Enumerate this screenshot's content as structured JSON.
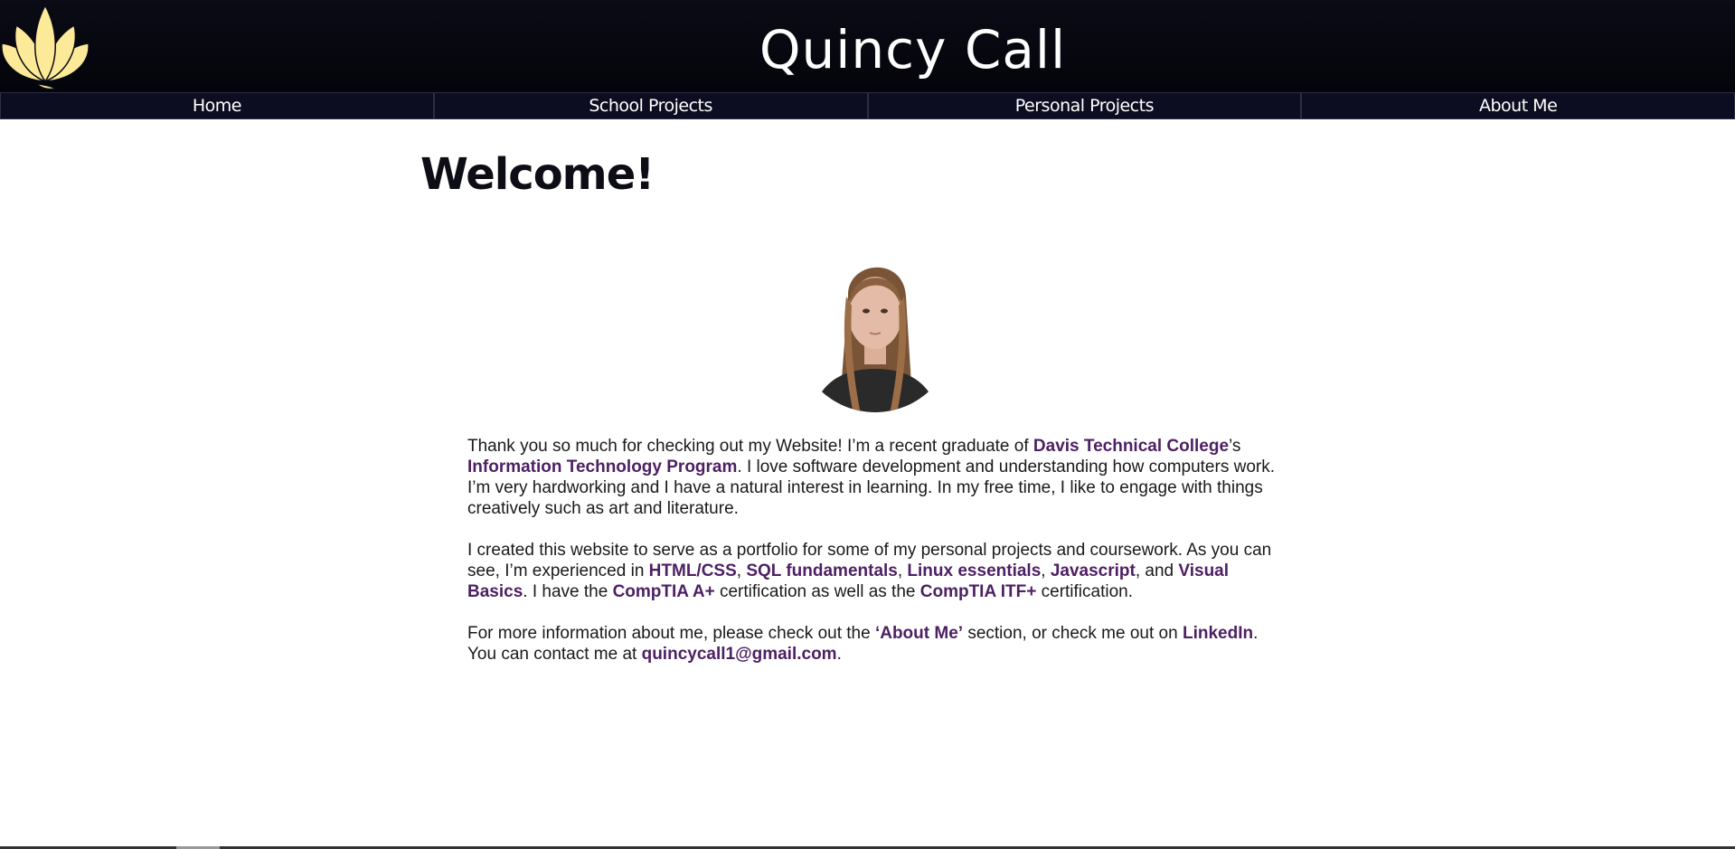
{
  "site": {
    "title": "Quincy Call"
  },
  "nav": {
    "items": [
      {
        "label": "Home"
      },
      {
        "label": "School Projects"
      },
      {
        "label": "Personal Projects"
      },
      {
        "label": "About Me"
      }
    ]
  },
  "main": {
    "heading": "Welcome!",
    "p1": {
      "t1": "Thank you so much for checking out my Website! I’m a recent graduate of ",
      "link1": "Davis Technical College",
      "t2": "’s ",
      "link2": "Information Technology Program",
      "t3": ". I love software development and understanding how computers work. I’m very hardworking and I have a natural interest in learning. In my free time, I like to engage with things creatively such as art and literature."
    },
    "p2": {
      "t1": "I created this website to serve as a portfolio for some of my personal projects and coursework. As you can see, I’m experienced in ",
      "link1": "HTML/CSS",
      "t2": ", ",
      "link2": "SQL fundamentals",
      "t3": ", ",
      "link3": "Linux essentials",
      "t4": ", ",
      "link4": "Javascript",
      "t5": ", and ",
      "link5": "Visual Basics",
      "t6": ". I have the ",
      "link6": "CompTIA A+",
      "t7": " certification as well as the ",
      "link7": "CompTIA ITF+",
      "t8": " certification."
    },
    "p3": {
      "t1": "For more information about me, please check out the ",
      "link1": "‘About Me’",
      "t2": " section, or check me out on ",
      "link2": "LinkedIn",
      "t3": ". You can contact me at ",
      "link3": "quincycall1@gmail.com",
      "t4": "."
    }
  },
  "colors": {
    "header_bg": "#05050c",
    "nav_bg": "#0d0d22",
    "link": "#4d1f63",
    "logo": "#fdea98"
  },
  "icons": {
    "logo": "lotus-flower-icon"
  }
}
